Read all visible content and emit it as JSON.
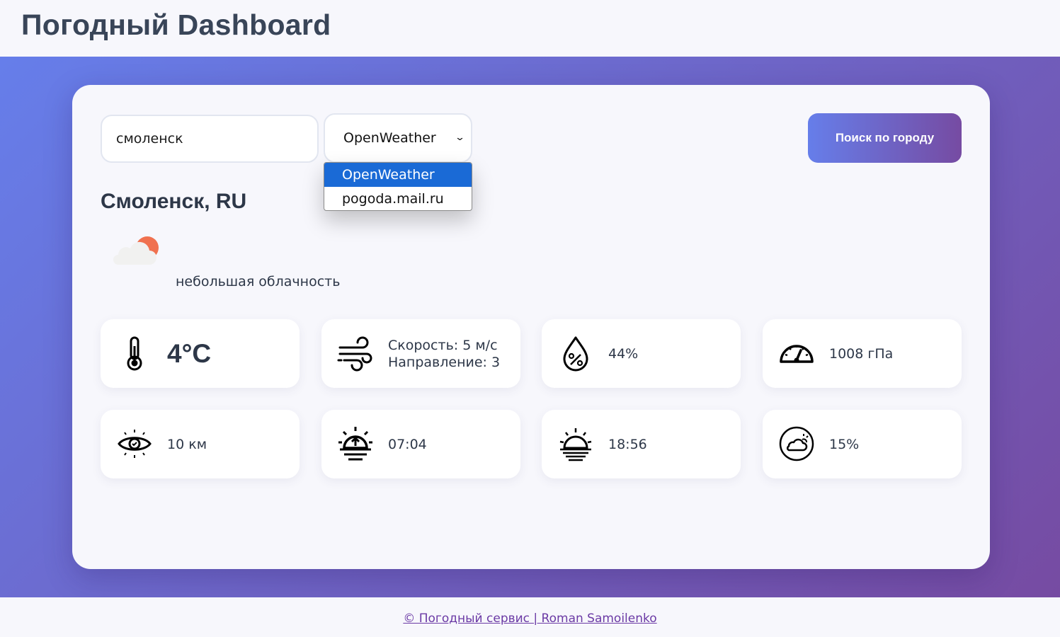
{
  "header": {
    "title": "Погодный Dashboard"
  },
  "search": {
    "city_value": "смоленск",
    "source_selected": "OpenWeather",
    "source_options": [
      "OpenWeather",
      "pogoda.mail.ru"
    ],
    "button_label": "Поиск по городу"
  },
  "location": {
    "name": "Смоленск, RU"
  },
  "current": {
    "description": "небольшая облачность",
    "icon": "partly-cloudy-icon"
  },
  "tiles": {
    "temperature": "4°C",
    "wind_speed": "Скорость: 5 м/с",
    "wind_direction": "Направление: 3",
    "humidity": "44%",
    "pressure": "1008 гПа",
    "visibility": "10 км",
    "sunrise": "07:04",
    "sunset": "18:56",
    "cloudiness": "15%"
  },
  "footer": {
    "text": "© Погодный сервис | Roman Samoilenko"
  },
  "colors": {
    "accent_start": "#667eea",
    "accent_end": "#764ba2",
    "dropdown_selected": "#1a6ad6"
  }
}
